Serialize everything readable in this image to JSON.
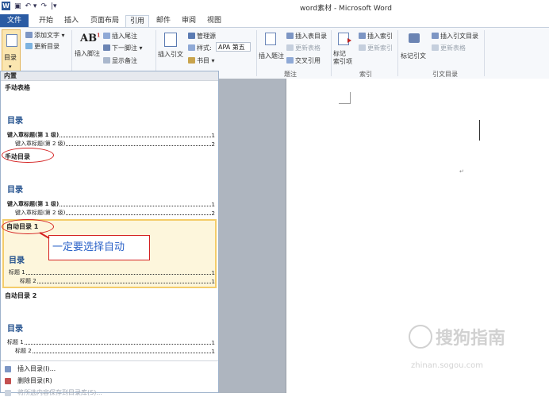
{
  "window": {
    "title": "word素材 - Microsoft Word"
  },
  "tabs": [
    "文件",
    "开始",
    "插入",
    "页面布局",
    "引用",
    "邮件",
    "审阅",
    "视图"
  ],
  "ribbon": {
    "toc_big": "目录",
    "add_text": "添加文字 ▾",
    "update_table": "更新目录",
    "insert_footnote": "插入脚注",
    "insert_endnote": "插入尾注",
    "next_footnote": "下一脚注 ▾",
    "show_notes": "显示备注",
    "insert_citation": "插入引文",
    "manage_sources": "管理源",
    "style_label": "样式:",
    "style_value": "APA 第五",
    "bibliography": "书目 ▾",
    "insert_caption": "插入题注",
    "insert_table_of_figures": "插入表目录",
    "update_table_fig": "更新表格",
    "cross_reference": "交叉引用",
    "mark_entry": "标记\n索引项",
    "insert_index": "插入索引",
    "update_index": "更新索引",
    "mark_citation": "标记引文",
    "insert_table_of_authorities": "插入引文目录",
    "update_table_auth": "更新表格",
    "groups": {
      "captions": "题注",
      "index": "索引",
      "authorities": "引文目录"
    }
  },
  "gallery": {
    "header": "内置",
    "manual_table": {
      "name": "手动表格",
      "title": "目录",
      "entries": [
        {
          "text": "键入章标题(第 1 级)",
          "page": "1",
          "level": 1
        },
        {
          "text": "键入章标题(第 2 级)",
          "page": "2",
          "level": 2
        }
      ]
    },
    "manual_toc": {
      "name": "手动目录",
      "title": "目录",
      "entries": [
        {
          "text": "键入章标题(第 1 级)",
          "page": "1",
          "level": 1
        },
        {
          "text": "键入章标题(第 2 级)",
          "page": "2",
          "level": 2
        }
      ]
    },
    "auto_toc_1": {
      "name": "自动目录 1",
      "title": "目录",
      "entries": [
        {
          "text": "标题 1",
          "page": "1",
          "level": 1
        },
        {
          "text": "标题 2",
          "page": "1",
          "level": 2
        }
      ]
    },
    "auto_toc_2": {
      "name": "自动目录 2",
      "title": "目录",
      "entries": [
        {
          "text": "标题 1",
          "page": "1",
          "level": 1
        },
        {
          "text": "标题 2",
          "page": "1",
          "level": 2
        }
      ]
    },
    "menu": {
      "insert_toc": "插入目录(I)...",
      "remove_toc": "删除目录(R)",
      "save_selection": "将所选内容保存到目录库(S)..."
    }
  },
  "annotation": {
    "callout": "一定要选择自动"
  },
  "watermark": {
    "text": "搜狗指南",
    "url": "zhinan.sogou.com"
  },
  "colors": {
    "accent": "#2a5ba3",
    "highlight_border": "#f4cc6a",
    "annotation_red": "#d42020",
    "annotation_blue": "#2c63c8"
  }
}
